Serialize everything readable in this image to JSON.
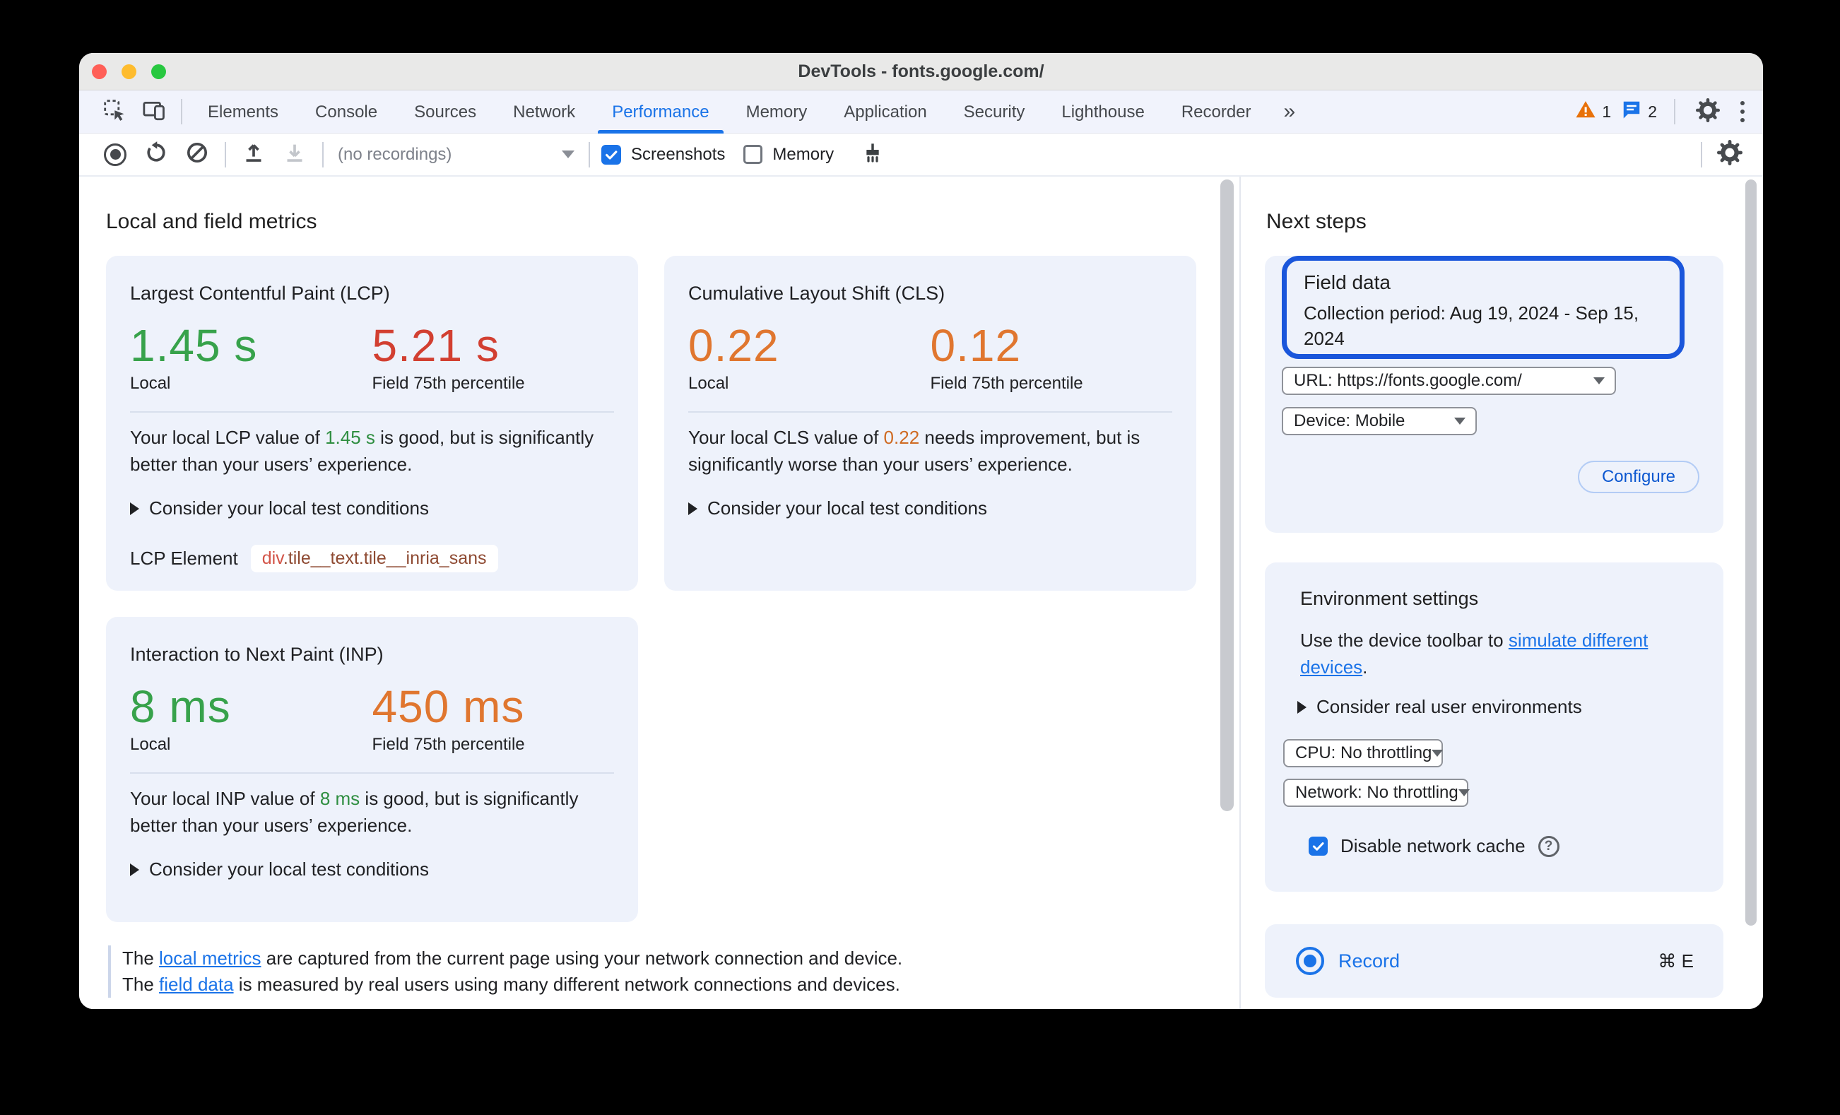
{
  "window": {
    "title": "DevTools - fonts.google.com/"
  },
  "tabs": {
    "items": [
      "Elements",
      "Console",
      "Sources",
      "Network",
      "Performance",
      "Memory",
      "Application",
      "Security",
      "Lighthouse",
      "Recorder"
    ],
    "selected": "Performance",
    "overflow_chevron": "»",
    "warning_count": "1",
    "message_count": "2"
  },
  "toolbar": {
    "recordings_dropdown": "(no recordings)",
    "screenshots_label": "Screenshots",
    "screenshots_checked": true,
    "memory_label": "Memory",
    "memory_checked": false
  },
  "main": {
    "heading": "Local and field metrics",
    "metrics": [
      {
        "title": "Largest Contentful Paint (LCP)",
        "local_value": "1.45 s",
        "field_value": "5.21 s",
        "local_label": "Local",
        "field_label": "Field 75th percentile",
        "desc_prefix": "Your local LCP value of ",
        "desc_value": "1.45 s",
        "desc_suffix": " is good, but is significantly better than your users’ experience.",
        "disclosure": "Consider your local test conditions",
        "element_label": "LCP Element",
        "element_tag": "div",
        "element_classes": ".tile__text.tile__inria_sans"
      },
      {
        "title": "Cumulative Layout Shift (CLS)",
        "local_value": "0.22",
        "field_value": "0.12",
        "local_label": "Local",
        "field_label": "Field 75th percentile",
        "desc_prefix": "Your local CLS value of ",
        "desc_value": "0.22",
        "desc_suffix": " needs improvement, but is significantly worse than your users’ experience.",
        "disclosure": "Consider your local test conditions"
      },
      {
        "title": "Interaction to Next Paint (INP)",
        "local_value": "8 ms",
        "field_value": "450 ms",
        "local_label": "Local",
        "field_label": "Field 75th percentile",
        "desc_prefix": "Your local INP value of ",
        "desc_value": "8 ms",
        "desc_suffix": " is good, but is significantly better than your users’ experience.",
        "disclosure": "Consider your local test conditions"
      }
    ],
    "footer": {
      "line1_prefix": "The ",
      "line1_link": "local metrics",
      "line1_suffix": " are captured from the current page using your network connection and device.",
      "line2_prefix": "The ",
      "line2_link": "field data",
      "line2_suffix": " is measured by real users using many different network connections and devices."
    }
  },
  "sidebar": {
    "heading": "Next steps",
    "field_data": {
      "title": "Field data",
      "collection_period": "Collection period: Aug 19, 2024 - Sep 15, 2024",
      "url_dropdown": "URL: https://fonts.google.com/",
      "device_dropdown": "Device: Mobile",
      "configure_button": "Configure"
    },
    "environment": {
      "title": "Environment settings",
      "desc_prefix": "Use the device toolbar to ",
      "desc_link": "simulate different devices",
      "desc_suffix": ".",
      "disclosure": "Consider real user environments",
      "cpu_dropdown": "CPU: No throttling",
      "network_dropdown": "Network: No throttling",
      "cache_label": "Disable network cache",
      "cache_checked": true
    },
    "record": {
      "label": "Record",
      "shortcut": "⌘ E"
    }
  },
  "colors": {
    "accent_blue": "#1a73e8",
    "focus_ring_blue": "#1a56db",
    "good_green": "#37a24b",
    "poor_red": "#d23f31",
    "needs_improvement_orange": "#e0762f",
    "warning_orange": "#e8710a",
    "card_background": "#eef2fb"
  }
}
